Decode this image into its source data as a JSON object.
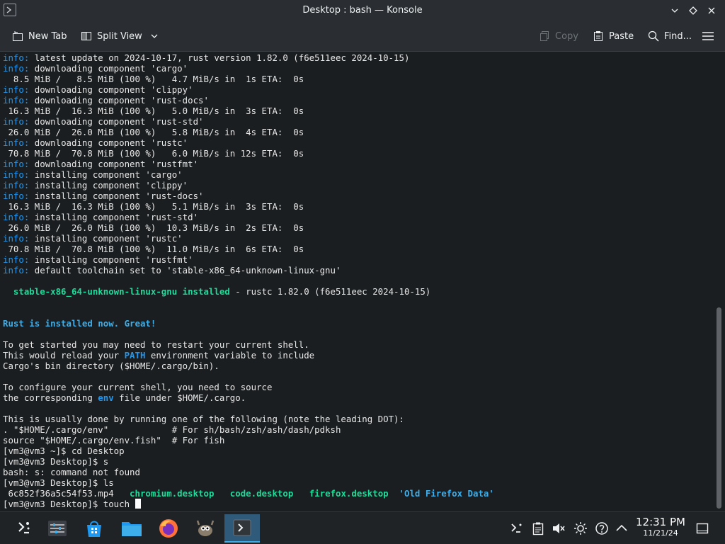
{
  "window": {
    "title": "Desktop : bash — Konsole"
  },
  "toolbar": {
    "new_tab": "New Tab",
    "split_view": "Split View",
    "copy": "Copy",
    "paste": "Paste",
    "find": "Find..."
  },
  "terminal": {
    "lines": [
      {
        "parts": [
          {
            "t": "info:",
            "c": "c-info"
          },
          {
            "t": " latest update on 2024-10-17, rust version 1.82.0 (f6e511eec 2024-10-15)"
          }
        ]
      },
      {
        "parts": [
          {
            "t": "info:",
            "c": "c-info"
          },
          {
            "t": " downloading component 'cargo'"
          }
        ]
      },
      {
        "parts": [
          {
            "t": "  8.5 MiB /   8.5 MiB (100 %)   4.7 MiB/s in  1s ETA:  0s"
          }
        ]
      },
      {
        "parts": [
          {
            "t": "info:",
            "c": "c-info"
          },
          {
            "t": " downloading component 'clippy'"
          }
        ]
      },
      {
        "parts": [
          {
            "t": "info:",
            "c": "c-info"
          },
          {
            "t": " downloading component 'rust-docs'"
          }
        ]
      },
      {
        "parts": [
          {
            "t": " 16.3 MiB /  16.3 MiB (100 %)   5.0 MiB/s in  3s ETA:  0s"
          }
        ]
      },
      {
        "parts": [
          {
            "t": "info:",
            "c": "c-info"
          },
          {
            "t": " downloading component 'rust-std'"
          }
        ]
      },
      {
        "parts": [
          {
            "t": " 26.0 MiB /  26.0 MiB (100 %)   5.8 MiB/s in  4s ETA:  0s"
          }
        ]
      },
      {
        "parts": [
          {
            "t": "info:",
            "c": "c-info"
          },
          {
            "t": " downloading component 'rustc'"
          }
        ]
      },
      {
        "parts": [
          {
            "t": " 70.8 MiB /  70.8 MiB (100 %)   6.0 MiB/s in 12s ETA:  0s"
          }
        ]
      },
      {
        "parts": [
          {
            "t": "info:",
            "c": "c-info"
          },
          {
            "t": " downloading component 'rustfmt'"
          }
        ]
      },
      {
        "parts": [
          {
            "t": "info:",
            "c": "c-info"
          },
          {
            "t": " installing component 'cargo'"
          }
        ]
      },
      {
        "parts": [
          {
            "t": "info:",
            "c": "c-info"
          },
          {
            "t": " installing component 'clippy'"
          }
        ]
      },
      {
        "parts": [
          {
            "t": "info:",
            "c": "c-info"
          },
          {
            "t": " installing component 'rust-docs'"
          }
        ]
      },
      {
        "parts": [
          {
            "t": " 16.3 MiB /  16.3 MiB (100 %)   5.1 MiB/s in  3s ETA:  0s"
          }
        ]
      },
      {
        "parts": [
          {
            "t": "info:",
            "c": "c-info"
          },
          {
            "t": " installing component 'rust-std'"
          }
        ]
      },
      {
        "parts": [
          {
            "t": " 26.0 MiB /  26.0 MiB (100 %)  10.3 MiB/s in  2s ETA:  0s"
          }
        ]
      },
      {
        "parts": [
          {
            "t": "info:",
            "c": "c-info"
          },
          {
            "t": " installing component 'rustc'"
          }
        ]
      },
      {
        "parts": [
          {
            "t": " 70.8 MiB /  70.8 MiB (100 %)  11.0 MiB/s in  6s ETA:  0s"
          }
        ]
      },
      {
        "parts": [
          {
            "t": "info:",
            "c": "c-info"
          },
          {
            "t": " installing component 'rustfmt'"
          }
        ]
      },
      {
        "parts": [
          {
            "t": "info:",
            "c": "c-info"
          },
          {
            "t": " default toolchain set to 'stable-x86_64-unknown-linux-gnu'"
          }
        ]
      },
      {
        "parts": []
      },
      {
        "parts": [
          {
            "t": "  "
          },
          {
            "t": "stable-x86_64-unknown-linux-gnu installed",
            "c": "c-teal"
          },
          {
            "t": " - rustc 1.82.0 (f6e511eec 2024-10-15)"
          }
        ]
      },
      {
        "parts": []
      },
      {
        "parts": []
      },
      {
        "parts": [
          {
            "t": "Rust is installed now. Great!",
            "c": "c-bold-blue"
          }
        ]
      },
      {
        "parts": []
      },
      {
        "parts": [
          {
            "t": "To get started you may need to restart your current shell."
          }
        ]
      },
      {
        "parts": [
          {
            "t": "This would reload your "
          },
          {
            "t": "PATH",
            "c": "c-blue-b"
          },
          {
            "t": " environment variable to include"
          }
        ]
      },
      {
        "parts": [
          {
            "t": "Cargo's bin directory ($HOME/.cargo/bin)."
          }
        ]
      },
      {
        "parts": []
      },
      {
        "parts": [
          {
            "t": "To configure your current shell, you need to source"
          }
        ]
      },
      {
        "parts": [
          {
            "t": "the corresponding "
          },
          {
            "t": "env",
            "c": "c-blue-b"
          },
          {
            "t": " file under $HOME/.cargo."
          }
        ]
      },
      {
        "parts": []
      },
      {
        "parts": [
          {
            "t": "This is usually done by running one of the following (note the leading DOT):"
          }
        ]
      },
      {
        "parts": [
          {
            "t": ". \"$HOME/.cargo/env\"            # For sh/bash/zsh/ash/dash/pdksh"
          }
        ]
      },
      {
        "parts": [
          {
            "t": "source \"$HOME/.cargo/env.fish\"  # For fish"
          }
        ]
      },
      {
        "parts": [
          {
            "t": "[vm3@vm3 ~]$ cd Desktop"
          }
        ]
      },
      {
        "parts": [
          {
            "t": "[vm3@vm3 Desktop]$ s"
          }
        ]
      },
      {
        "parts": [
          {
            "t": "bash: s: command not found"
          }
        ]
      },
      {
        "parts": [
          {
            "t": "[vm3@vm3 Desktop]$ ls"
          }
        ]
      },
      {
        "parts": [
          {
            "t": " 6c852f36a5c54f53.mp4   "
          },
          {
            "t": "chromium.desktop",
            "c": "c-teal"
          },
          {
            "t": "   "
          },
          {
            "t": "code.desktop",
            "c": "c-teal"
          },
          {
            "t": "   "
          },
          {
            "t": "firefox.desktop",
            "c": "c-teal"
          },
          {
            "t": "  "
          },
          {
            "t": "'Old Firefox Data'",
            "c": "c-bold-blue"
          }
        ]
      },
      {
        "parts": [
          {
            "t": "[vm3@vm3 Desktop]$ touch "
          }
        ],
        "cursor": true
      }
    ]
  },
  "taskbar": {
    "apps": [
      "application-launcher",
      "system-settings",
      "discover",
      "dolphin",
      "firefox",
      "gimp",
      "konsole"
    ],
    "clock_time": "12:31 PM",
    "clock_date": "11/21/24"
  }
}
